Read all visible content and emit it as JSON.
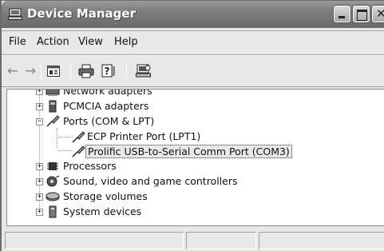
{
  "window": {
    "title": "Device Manager",
    "icon": "device-manager-computer-icon"
  },
  "titlebar_buttons": [
    "minimize",
    "maximize",
    "close"
  ],
  "menu": {
    "file": "File",
    "action": "Action",
    "view": "View",
    "help": "Help"
  },
  "toolbar": {
    "back": "←",
    "forward": "→",
    "icons": [
      "back-arrow-icon",
      "forward-arrow-icon",
      "properties-icon",
      "print-icon",
      "help-icon",
      "scan-hardware-icon"
    ]
  },
  "tree": {
    "items": [
      {
        "label": "Network adapters",
        "icon": "network-adapter-icon",
        "expander": "+"
      },
      {
        "label": "PCMCIA adapters",
        "icon": "pcmcia-icon",
        "expander": "+"
      },
      {
        "label": "Ports (COM & LPT)",
        "icon": "port-connector-icon",
        "expander": "−"
      },
      {
        "label": "ECP Printer Port (LPT1)",
        "icon": "port-connector-icon"
      },
      {
        "label": "Prolific USB-to-Serial Comm Port (COM3)",
        "icon": "port-connector-icon",
        "selected": true
      },
      {
        "label": "Processors",
        "icon": "processor-icon",
        "expander": "+"
      },
      {
        "label": "Sound, video and game controllers",
        "icon": "sound-icon",
        "expander": "+"
      },
      {
        "label": "Storage volumes",
        "icon": "storage-volume-icon",
        "expander": "+"
      },
      {
        "label": "System devices",
        "icon": "system-devices-icon",
        "expander": "+"
      }
    ]
  },
  "statusbar": {
    "cells": [
      "",
      "",
      ""
    ]
  }
}
